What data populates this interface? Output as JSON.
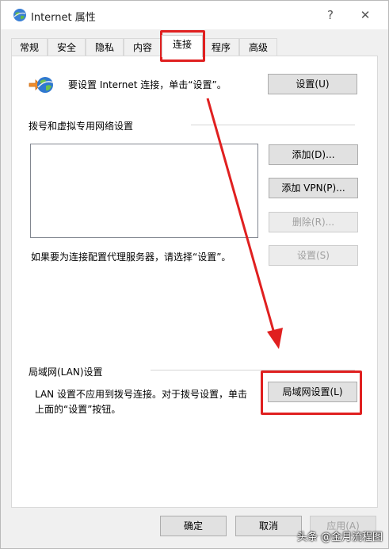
{
  "window": {
    "title": "Internet 属性",
    "help": "?",
    "close": "✕"
  },
  "tabs": [
    "常规",
    "安全",
    "隐私",
    "内容",
    "连接",
    "程序",
    "高级"
  ],
  "active_tab": "连接",
  "setup": {
    "text": "要设置 Internet 连接，单击“设置”。",
    "button": "设置(U)"
  },
  "dialup": {
    "heading": "拨号和虚拟专用网络设置",
    "add": "添加(D)...",
    "add_vpn": "添加 VPN(P)...",
    "remove": "删除(R)...",
    "proxy_text": "如果要为连接配置代理服务器，请选择“设置”。",
    "settings": "设置(S)"
  },
  "lan": {
    "heading": "局域网(LAN)设置",
    "text_line1": "LAN 设置不应用到拨号连接。对于拨号设置，单击",
    "text_line2": "上面的“设置”按钮。",
    "button": "局域网设置(L)"
  },
  "footer": {
    "ok": "确定",
    "cancel": "取消",
    "apply": "应用(A)"
  },
  "watermark": "头条 @金月流程图",
  "colors": {
    "highlight": "#e02020"
  }
}
